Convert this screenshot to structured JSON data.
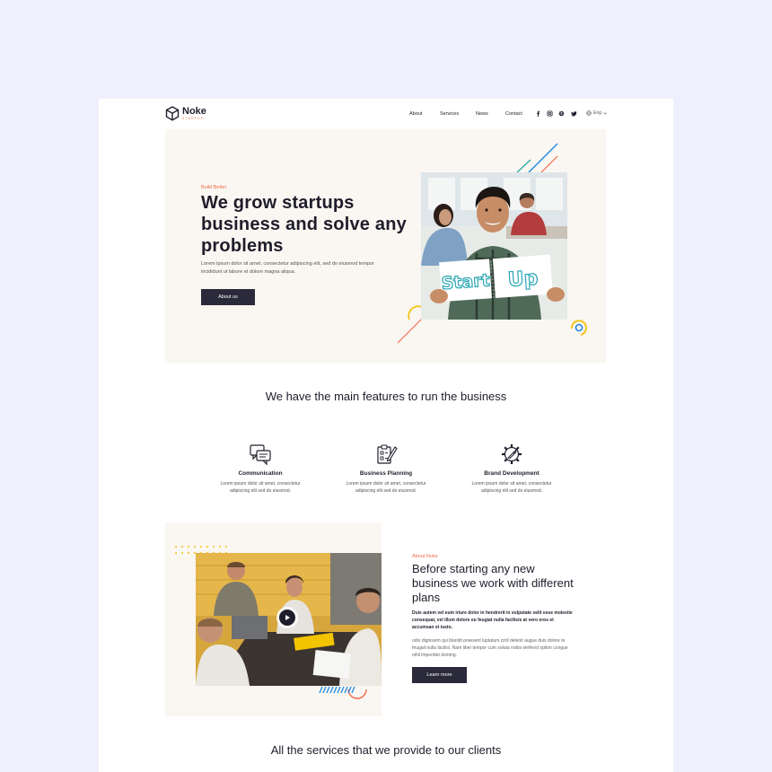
{
  "brand": {
    "name": "Noke",
    "tagline": "STARTUP"
  },
  "nav": {
    "items": [
      "About",
      "Services",
      "News",
      "Contact"
    ],
    "lang": "Eng"
  },
  "social": [
    "facebook-icon",
    "instagram-icon",
    "dribbble-icon",
    "twitter-icon"
  ],
  "hero": {
    "eyebrow": "Build Better",
    "title": "We grow startups business and solve any problems",
    "text": "Lorem ipsum dolor sit amet, consectetur adipiscing elit, sed do eiusmod tempor incididunt ut labore et dolore magna aliqua.",
    "button": "About us",
    "sign_left": "Start",
    "sign_right": "Up"
  },
  "features": {
    "title": "We have the main features to run the business",
    "items": [
      {
        "icon": "chat-bubbles-icon",
        "title": "Communication",
        "text": "Lorem ipsum dolor sit amet, consectetur adipiscing elit sed do eiusmod."
      },
      {
        "icon": "planning-icon",
        "title": "Business Planning",
        "text": "Lorem ipsum dolor sit amet, consectetur adipiscing elit sed do eiusmod."
      },
      {
        "icon": "gear-rocket-icon",
        "title": "Brand Development",
        "text": "Lorem ipsum dolor sit amet, consectetur adipiscing elit sed do eiusmod."
      }
    ]
  },
  "about": {
    "eyebrow": "About Noke",
    "title": "Before starting any new business we work with different plans",
    "p1": "Duis autem vel eum iriure dolor in hendrerit in vulputate velit esse molestie consequat, vel illum dolore eu feugiat nulla facilisis at vero eros et accumsan et iusto.",
    "p2": "odio dignissim qui blandit praesent luptatum zzril delenit augue duis dolore te feugait nulla facilisi. Nam liber tempor cum soluta nobis eleifend option congue nihil imperdiet doming.",
    "button": "Learn more"
  },
  "services": {
    "title": "All the services that we provide to our clients"
  },
  "colors": {
    "accent": "#f26b4a",
    "dark": "#2b2a3a",
    "cream": "#faf6f1",
    "backdrop": "#efeffd",
    "blue": "#1e88e5",
    "yellow": "#f5c518",
    "teal": "#26a69a"
  }
}
